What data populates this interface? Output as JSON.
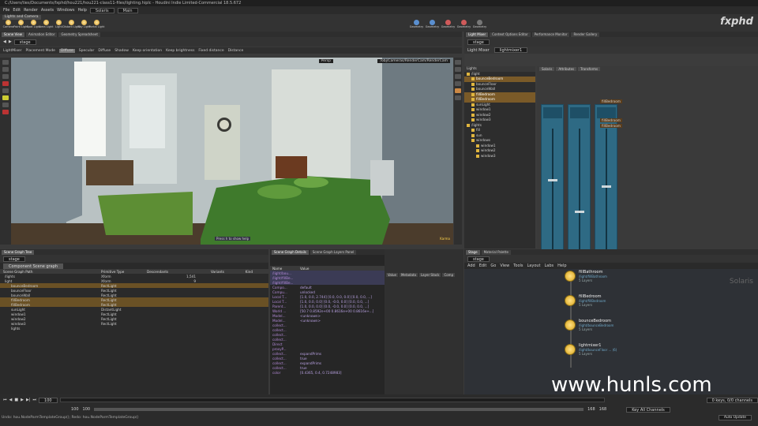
{
  "app": {
    "title": "C:/Users/ties/Documents/fxphd/hou221/hou221-class11-files/lighting.hiplc - Houdini Indie Limited-Commercial 18.5.672"
  },
  "menu": [
    "File",
    "Edit",
    "Render",
    "Assets",
    "Windows",
    "Help"
  ],
  "desktop": "Solaris",
  "context": "Main",
  "shelf": {
    "tabs": [
      "Lights and Camera"
    ],
    "tools": [
      "Camera",
      "Point Light",
      "Spot Light",
      "Area Light",
      "Light",
      "Distant Light",
      "Sky Light",
      "Portal Light"
    ],
    "right_tools": [
      "Geometry",
      "Geometry",
      "Geometry",
      "Geometry",
      "Geometry"
    ]
  },
  "panes": {
    "left_tabs": [
      "Scene View",
      "Animation Editor",
      "Geometry Spreadsheet"
    ],
    "right_tabs": [
      "Light Mixer",
      "Context Options Editor",
      "Performance Monitor",
      "Render Gallery"
    ],
    "stage": "stage",
    "stage2": "stage"
  },
  "viewport": {
    "toolbar": [
      "LightMixer",
      "Placement Mode",
      "Diffuse",
      "Specular",
      "Diffuse",
      "Shadow",
      "Keep orientation",
      "Keep brightness",
      "Fixed distance",
      "Distance"
    ],
    "camera": "Persp",
    "camera_path": "/obj/Cameras/RenderCam/RenderCam",
    "hint": "Press h to show help",
    "renderer": "Karma",
    "tooltip": "/lights/window1"
  },
  "lightmixer": {
    "node_label": "Light Mixer",
    "node_name": "lightmixer1",
    "tree_header": "Lights",
    "subtabs": [
      "Solaris",
      "Attributes",
      "Transforms"
    ],
    "tree": [
      {
        "label": "/light",
        "depth": 0
      },
      {
        "label": "bounceBedroom",
        "depth": 1,
        "hl": true
      },
      {
        "label": "bounceFloor",
        "depth": 1
      },
      {
        "label": "bounceWall",
        "depth": 1
      },
      {
        "label": "fillBedroom",
        "depth": 1,
        "hl": true
      },
      {
        "label": "fillBedroom",
        "depth": 1,
        "hl": true
      },
      {
        "label": "sunLight",
        "depth": 1
      },
      {
        "label": "window1",
        "depth": 1
      },
      {
        "label": "window2",
        "depth": 1
      },
      {
        "label": "window3",
        "depth": 1
      },
      {
        "label": "/lights",
        "depth": 0
      },
      {
        "label": "fill",
        "depth": 1
      },
      {
        "label": "sun",
        "depth": 1
      },
      {
        "label": "windows",
        "depth": 1
      },
      {
        "label": "window1",
        "depth": 2
      },
      {
        "label": "window2",
        "depth": 2
      },
      {
        "label": "window3",
        "depth": 2
      }
    ],
    "drop_labels": [
      "fillBedroom",
      "fillBedroom",
      "fillBedroom"
    ],
    "fader_levels": [
      0.6,
      0.35,
      0.55
    ]
  },
  "scene_tree": {
    "tabs": [
      "Scene Graph Tree",
      "Scene Graph Details",
      "Scene Graph Layers Panel"
    ],
    "dropdown": "Component Scene graph",
    "columns": [
      "Scene Graph Path",
      "Primitive Type",
      "Descendants",
      "Variants",
      "Kind"
    ],
    "rows": [
      {
        "p": "/lights",
        "t": "Xform",
        "d": "1,541",
        "h": false
      },
      {
        "p": "light",
        "t": "Xform",
        "d": "9",
        "h": false
      },
      {
        "p": "bounceBedroom",
        "t": "RectLight",
        "d": "",
        "h": true
      },
      {
        "p": "bounceFloor",
        "t": "RectLight",
        "d": "",
        "h": false
      },
      {
        "p": "bounceWall",
        "t": "RectLight",
        "d": "",
        "h": false
      },
      {
        "p": "fillBedroom",
        "t": "RectLight",
        "d": "",
        "h": true
      },
      {
        "p": "fillBedroom",
        "t": "RectLight",
        "d": "",
        "h": true
      },
      {
        "p": "sunLight",
        "t": "DistantLight",
        "d": "",
        "h": false
      },
      {
        "p": "window1",
        "t": "RectLight",
        "d": "",
        "h": false
      },
      {
        "p": "window2",
        "t": "RectLight",
        "d": "",
        "h": false
      },
      {
        "p": "window3",
        "t": "RectLight",
        "d": "",
        "h": false
      },
      {
        "p": "lights",
        "t": "",
        "d": "",
        "h": false
      }
    ]
  },
  "details": {
    "columns": [
      "Name",
      "Value"
    ],
    "rows": [
      [
        "/light/bou...",
        ""
      ],
      [
        "/light/fillBe...",
        ""
      ],
      [
        "/light/fillBe...",
        ""
      ],
      [
        "Compo...",
        "default"
      ],
      [
        "Compu...",
        "unlocked"
      ],
      [
        "Local T...",
        "[1.0, 0.0, 2.744] [0.0, 0.0, 0.0] [0.0, 0.0, ...]"
      ],
      [
        "Local T...",
        "[1.0, 0.0, 0.0] [0.0, -0.0, 0.0] [0.0, 0.0, ...]"
      ],
      [
        "Parent...",
        "[1.0, 0.0, 0.0] [0.0, -0.0, 0.0] [0.0, 0.0, ...]"
      ],
      [
        "World ...",
        "[50.7 0.8592e+00 0.8616e+00 0.8616e+...]"
      ],
      [
        "Model...",
        "<unknown>"
      ],
      [
        "Model...",
        "<unknown>"
      ],
      [
        "collect...",
        ""
      ],
      [
        "collect...",
        ""
      ],
      [
        "collect...",
        ""
      ],
      [
        "collect...",
        ""
      ],
      [
        "Direct",
        ""
      ],
      [
        "proxyP...",
        ""
      ],
      [
        "collect...",
        "expandPrims"
      ],
      [
        "collect...",
        "true"
      ],
      [
        "collect...",
        "expandPrims"
      ],
      [
        "collect...",
        "true"
      ],
      [
        "color",
        "[0.4365, 0.4, 0.7248983]"
      ]
    ]
  },
  "attr_tabs": [
    "Value",
    "Metadata",
    "Layer Stack",
    "Comp"
  ],
  "network": {
    "menu": [
      "Add",
      "Edit",
      "Go",
      "View",
      "Tools",
      "Layout",
      "Labs",
      "Help"
    ],
    "path": "stage",
    "label": "Solaris",
    "tabs": [
      "Stage",
      "Material Palette"
    ],
    "nodes": [
      {
        "name": "fillBathroom",
        "path": "/light/fillBathroom",
        "layers": "5 Layers"
      },
      {
        "name": "fillBedroom",
        "path": "/light/fillBedroom",
        "layers": "5 Layers"
      },
      {
        "name": "bounceBedroom",
        "path": "/light/bounceBedroom",
        "layers": "5 Layers"
      },
      {
        "name": "lightmixer1",
        "path": "/light/bounceFloor ... (6)",
        "layers": "5 Layers"
      }
    ]
  },
  "timeline": {
    "frame": "100",
    "start": "100",
    "end": "100",
    "range_start": "100",
    "range_end": "168",
    "range_end2": "168",
    "status": "Undo: hou.NodeParmTemplateGroup(); Redo: hou.NodeParmTemplateGroup()",
    "keys": "0 keys, 0/0 channels",
    "key_all": "Key All Channels",
    "auto": "Auto Update"
  },
  "watermark": "www.hunls.com",
  "logo": "fxphd"
}
